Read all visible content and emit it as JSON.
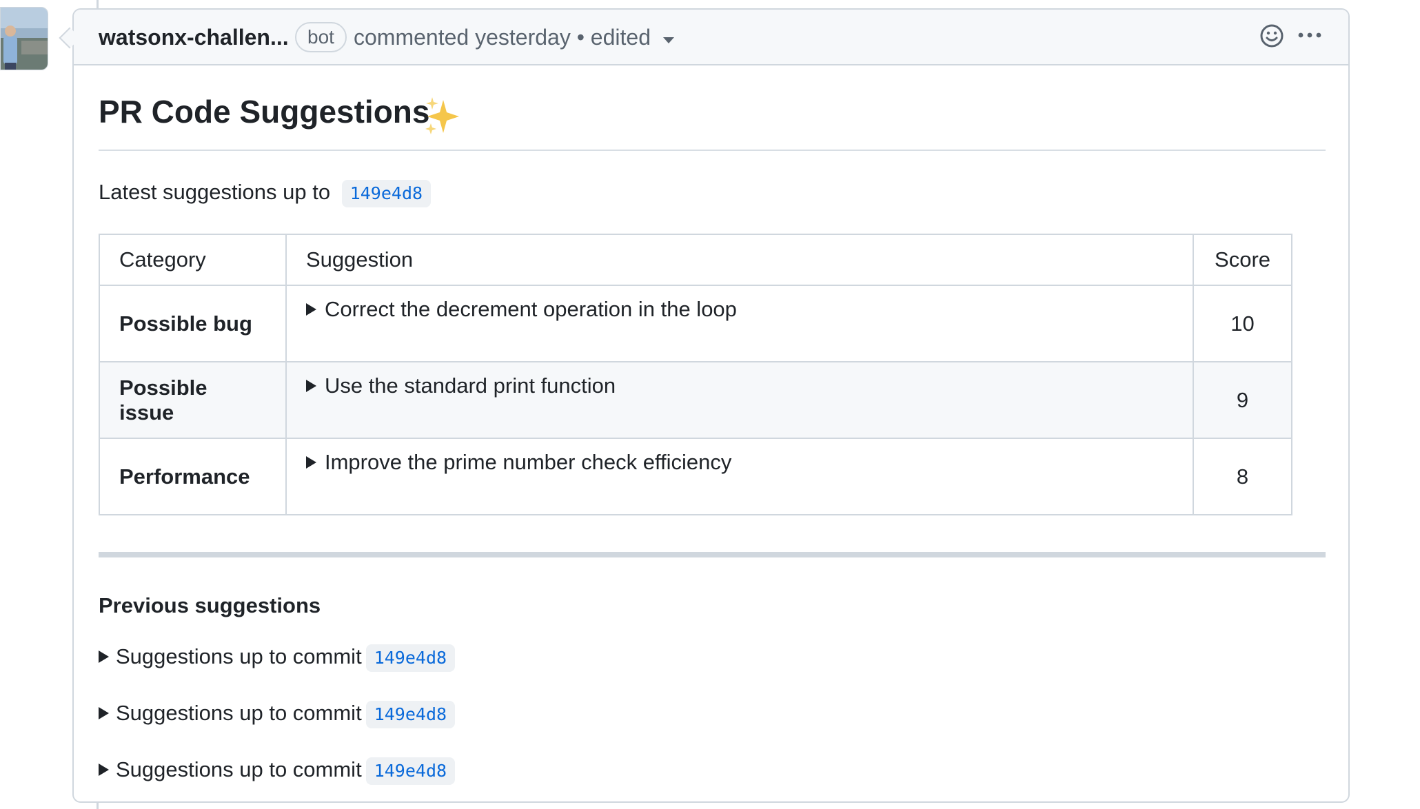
{
  "comment": {
    "author": "watsonx-challen...",
    "badge": "bot",
    "meta": "commented yesterday • edited"
  },
  "body": {
    "title": "PR Code Suggestions",
    "title_emoji": "✨",
    "latest_prefix": "Latest suggestions up to",
    "latest_commit": "149e4d8",
    "table": {
      "headers": [
        "Category",
        "Suggestion",
        "Score"
      ],
      "rows": [
        {
          "category": "Possible bug",
          "suggestion": "Correct the decrement operation in the loop",
          "score": "10"
        },
        {
          "category": "Possible issue",
          "suggestion": "Use the standard print function",
          "score": "9"
        },
        {
          "category": "Performance",
          "suggestion": "Improve the prime number check efficiency",
          "score": "8"
        }
      ]
    },
    "previous": {
      "heading": "Previous suggestions",
      "items": [
        {
          "label": "Suggestions up to commit",
          "commit": "149e4d8"
        },
        {
          "label": "Suggestions up to commit",
          "commit": "149e4d8"
        },
        {
          "label": "Suggestions up to commit",
          "commit": "149e4d8"
        }
      ]
    }
  },
  "icons": {
    "header_actions": [
      "smiley-icon",
      "kebab-menu-icon"
    ],
    "expand": "triangle-right-icon",
    "caret": "chevron-down-icon"
  }
}
